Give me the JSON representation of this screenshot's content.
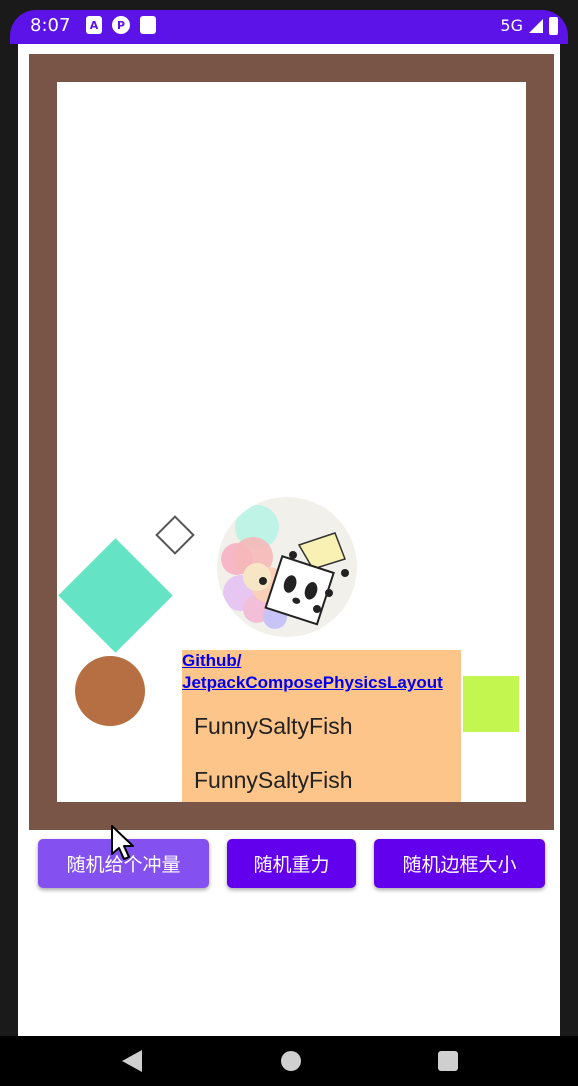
{
  "status_bar": {
    "time": "8:07",
    "left_icons": [
      "a-icon",
      "p-icon",
      "sd-card-icon"
    ],
    "network": "5G",
    "accent_color": "#5b13e8"
  },
  "physics_arena": {
    "frame_color": "#795548",
    "shapes": [
      {
        "name": "teal-diamond",
        "color": "#64e3c5"
      },
      {
        "name": "outline-diamond",
        "color": "#ffffff"
      },
      {
        "name": "avatar-ball",
        "icon": "panda-avatar"
      },
      {
        "name": "brown-circle",
        "color": "#b56f42"
      },
      {
        "name": "lime-square",
        "color": "#c3f64e"
      }
    ],
    "card": {
      "color": "#fdc58a",
      "link_line1": "Github/",
      "link_line2": "JetpackComposePhysicsLayout",
      "text1": "FunnySaltyFish",
      "text2": "FunnySaltyFish"
    }
  },
  "buttons": {
    "random_impulse": "随机给个冲量",
    "random_gravity": "随机重力",
    "random_border_size": "随机边框大小"
  },
  "nav_bar": {
    "icons": [
      "back-icon",
      "home-icon",
      "recents-icon"
    ]
  }
}
